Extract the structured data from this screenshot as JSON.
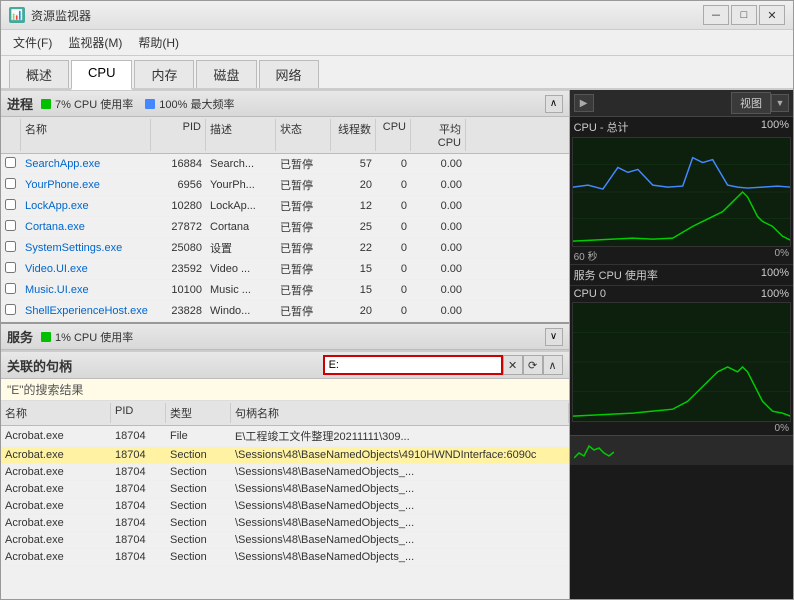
{
  "window": {
    "title": "资源监视器",
    "icon": "📊"
  },
  "menu": {
    "items": [
      "文件(F)",
      "监视器(M)",
      "帮助(H)"
    ]
  },
  "tabs": [
    {
      "label": "概述",
      "active": false
    },
    {
      "label": "CPU",
      "active": true
    },
    {
      "label": "内存",
      "active": false
    },
    {
      "label": "磁盘",
      "active": false
    },
    {
      "label": "网络",
      "active": false
    }
  ],
  "process_section": {
    "title": "进程",
    "cpu_usage": "7% CPU 使用率",
    "max_freq": "100% 最大频率"
  },
  "process_table": {
    "headers": [
      "",
      "名称",
      "PID",
      "描述",
      "状态",
      "线程数",
      "CPU",
      "平均 CPU"
    ],
    "rows": [
      {
        "name": "SearchApp.exe",
        "pid": "16884",
        "desc": "Search...",
        "status": "已暂停",
        "threads": "57",
        "cpu": "0",
        "avgcpu": "0.00"
      },
      {
        "name": "YourPhone.exe",
        "pid": "6956",
        "desc": "YourPh...",
        "status": "已暂停",
        "threads": "20",
        "cpu": "0",
        "avgcpu": "0.00"
      },
      {
        "name": "LockApp.exe",
        "pid": "10280",
        "desc": "LockAp...",
        "status": "已暂停",
        "threads": "12",
        "cpu": "0",
        "avgcpu": "0.00"
      },
      {
        "name": "Cortana.exe",
        "pid": "27872",
        "desc": "Cortana",
        "status": "已暂停",
        "threads": "25",
        "cpu": "0",
        "avgcpu": "0.00"
      },
      {
        "name": "SystemSettings.exe",
        "pid": "25080",
        "desc": "设置",
        "status": "已暂停",
        "threads": "22",
        "cpu": "0",
        "avgcpu": "0.00"
      },
      {
        "name": "Video.UI.exe",
        "pid": "23592",
        "desc": "Video ...",
        "status": "已暂停",
        "threads": "15",
        "cpu": "0",
        "avgcpu": "0.00"
      },
      {
        "name": "Music.UI.exe",
        "pid": "10100",
        "desc": "Music ...",
        "status": "已暂停",
        "threads": "15",
        "cpu": "0",
        "avgcpu": "0.00"
      },
      {
        "name": "ShellExperienceHost.exe",
        "pid": "23828",
        "desc": "Windo...",
        "status": "已暂停",
        "threads": "20",
        "cpu": "0",
        "avgcpu": "0.00"
      }
    ]
  },
  "service_section": {
    "title": "服务",
    "cpu_usage": "1% CPU 使用率"
  },
  "handle_section": {
    "title": "关联的句柄",
    "search_value": "E:",
    "search_results_label": "\"E\"的搜索结果",
    "headers": [
      "名称",
      "PID",
      "类型",
      "句柄名称"
    ]
  },
  "handle_rows": [
    {
      "name": "Acrobat.exe",
      "pid": "18704",
      "type": "File",
      "hname": "E\\工程竣工文件整理20211111\\309...",
      "highlighted": false
    },
    {
      "name": "Acrobat.exe",
      "pid": "18704",
      "type": "Section",
      "hname": "\\Sessions\\48\\BaseNamedObjects\\4910HWNDInterface:6090c",
      "highlighted": true
    },
    {
      "name": "Acrobat.exe",
      "pid": "18704",
      "type": "Section",
      "hname": "\\Sessions\\48\\BaseNamedObjects_...",
      "highlighted": false
    },
    {
      "name": "Acrobat.exe",
      "pid": "18704",
      "type": "Section",
      "hname": "\\Sessions\\48\\BaseNamedObjects_...",
      "highlighted": false
    },
    {
      "name": "Acrobat.exe",
      "pid": "18704",
      "type": "Section",
      "hname": "\\Sessions\\48\\BaseNamedObjects_...",
      "highlighted": false
    },
    {
      "name": "Acrobat.exe",
      "pid": "18704",
      "type": "Section",
      "hname": "\\Sessions\\48\\BaseNamedObjects_...",
      "highlighted": false
    },
    {
      "name": "Acrobat.exe",
      "pid": "18704",
      "type": "Section",
      "hname": "\\Sessions\\48\\BaseNamedObjects_...",
      "highlighted": false
    },
    {
      "name": "Acrobat.exe",
      "pid": "18704",
      "type": "Section",
      "hname": "\\Sessions\\48\\BaseNamedObjects_...",
      "highlighted": false
    }
  ],
  "right_panel": {
    "view_label": "视图",
    "cpu_total_label": "CPU - 总计",
    "cpu_total_pct": "100%",
    "cpu_total_0pct": "0%",
    "service_cpu_label": "服务 CPU 使用率",
    "service_cpu_pct": "100%",
    "cpu0_label": "CPU 0",
    "cpu0_pct": "100%",
    "cpu0_0pct": "0%",
    "time_label": "60 秒"
  },
  "title_bar_buttons": {
    "minimize": "－",
    "maximize": "□",
    "close": "✕"
  }
}
